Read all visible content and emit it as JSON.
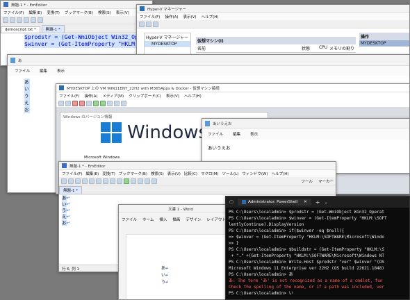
{
  "emeditor_back": {
    "title": "無題-1 * - EmEditor",
    "menu": [
      "ファイル(F)",
      "編集(E)",
      "変換(T)",
      "ブックマーク(B)",
      "検索(S)",
      "表示(V)"
    ],
    "tabs": [
      "demoscript.txt *",
      "無題-1 *"
    ],
    "code_lines": [
      "$prodstr = (Get-WmiObject Win32_Oper",
      "$winver = (Get-ItemProperty \"HKLM:\\S"
    ]
  },
  "hyperv": {
    "title": "Hyper-V マネージャー",
    "menu": [
      "ファイル(F)",
      "操作(A)",
      "表示(V)",
      "ヘルプ(H)"
    ],
    "tree_root": "Hyper-V マネージャー",
    "tree_item": "MYDESKTOP",
    "panel_title": "仮想マシン(I)",
    "columns": [
      "名前",
      "状態",
      "CPU",
      "メモリの割り"
    ],
    "actions_title": "操作",
    "actions_item": "MYDESKTOP"
  },
  "notepad_back": {
    "title": "あ",
    "menu": [
      "ファイル",
      "編集",
      "表示"
    ],
    "vertical_text": [
      "あ",
      "い",
      "う",
      "え",
      "お"
    ]
  },
  "vm": {
    "title": "MYDESKTOP 上の VM WIN11ENT_22H2 with M365Apps & Docker - 仮想マシン接続",
    "menu": [
      "ファイル(F)",
      "操作(A)",
      "メディア(M)",
      "クリップボード(C)",
      "表示(V)",
      "ヘルプ(H)"
    ],
    "winver_title": "Windows のバージョン情報",
    "windows_brand": "Windows 11",
    "ms_windows": "Microsoft Windows"
  },
  "notepad_front": {
    "title": "あいうえお",
    "menu": [
      "ファイル",
      "編集",
      "表示"
    ],
    "content": "あいうえお"
  },
  "emeditor_front": {
    "title": "無題-1 * - EmEditor",
    "menu": [
      "ファイル(F)",
      "編集(E)",
      "変換(T)",
      "ブックマーク(B)",
      "検索(S)",
      "表示(V)",
      "比較(C)",
      "マクロ(M)",
      "ツール(L)",
      "ウィンドウ(W)",
      "ヘルプ(H)"
    ],
    "tab": "無題-1 *",
    "lines": [
      "あ",
      "い",
      "う",
      "え",
      "お"
    ],
    "line_numbers": [
      "1",
      "2",
      "3",
      "4",
      "5"
    ],
    "status": "行 6, 列 1",
    "toolbar_label": "ツール",
    "toolbar_label2": "マーカー"
  },
  "word": {
    "title": "文書 1 - Word",
    "menu": [
      "ファイル",
      "ホーム",
      "挿入",
      "描画",
      "デザイン",
      "レイアウト"
    ],
    "doc_lines": [
      "あ",
      "い",
      "う"
    ]
  },
  "powershell": {
    "tab_title": "Administrator: PowerShell",
    "lines": [
      {
        "text": "PS C:\\Users\\localadmin> $prodstr = (Get-WmiObject Win32_Operat",
        "color": "#e8e8e8"
      },
      {
        "text": "PS C:\\Users\\localadmin> $winver = (Get-ItemProperty \"HKLM:\\SOFT",
        "color": "#e8e8e8"
      },
      {
        "text": "lentlyContinue).DisplayVersion",
        "color": "#e8e8e8"
      },
      {
        "text": "PS C:\\Users\\localadmin> if($winver -eq $null){",
        "color": "#e8e8e8"
      },
      {
        "text": ">> $winver = (Get-ItemProperty \"HKLM:\\SOFTWARE\\Microsoft\\Windo",
        "color": "#e8e8e8"
      },
      {
        "text": ">> }",
        "color": "#e8e8e8"
      },
      {
        "text": "PS C:\\Users\\localadmin> $buildstr = (Get-ItemProperty \"HKLM:\\S",
        "color": "#e8e8e8"
      },
      {
        "text": " + \".\" +(Get-ItemProperty \"HKLM:\\SOFTWARE\\Microsoft\\Windows NT",
        "color": "#e8e8e8"
      },
      {
        "text": "PS C:\\Users\\localadmin> Write-Host $prodstr \"ver\" $winver \"(OS",
        "color": "#e8e8e8"
      },
      {
        "text": "Microsoft Windows 11 Enterprise ver 22H2 (OS build 22621.1848)",
        "color": "#e8e8e8"
      },
      {
        "text": "PS C:\\Users\\localadmin> あ",
        "color": "#e8e8e8"
      },
      {
        "text": "あ: The term 'あ' is not recognized as a name of a cmdlet, fun",
        "color": "#ff5f5f"
      },
      {
        "text": "Check the spelling of the name, or if a path was included, ver",
        "color": "#ff5f5f"
      },
      {
        "text": "PS C:\\Users\\localadmin> い",
        "color": "#e8e8e8"
      }
    ]
  }
}
